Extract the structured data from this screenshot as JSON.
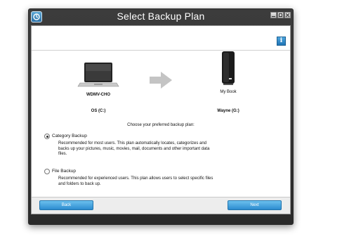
{
  "window": {
    "title": "Select Backup Plan"
  },
  "source": {
    "computer_name": "WDMV-CHO",
    "drive": "OS (C:)"
  },
  "target": {
    "device_name": "My Book",
    "drive": "Wayne (G:)"
  },
  "prompt": "Choose your preferred backup plan:",
  "options": [
    {
      "label": "Category Backup",
      "selected": true,
      "description": "Recommended for most users. This plan automatically locates, categorizes and backs up your pictures, music, movies, mail, documents and other important data files."
    },
    {
      "label": "File Backup",
      "selected": false,
      "description": "Recommended for experienced users. This plan allows users to select specific files and folders to back up."
    }
  ],
  "buttons": {
    "back": "Back",
    "next": "Next"
  },
  "icons": {
    "app": "wd-app-icon",
    "help": "info-icon",
    "source": "laptop-icon",
    "arrow": "arrow-right-icon",
    "target": "external-drive-icon"
  },
  "colors": {
    "accent": "#3a96d6",
    "titlebar": "#333333"
  }
}
